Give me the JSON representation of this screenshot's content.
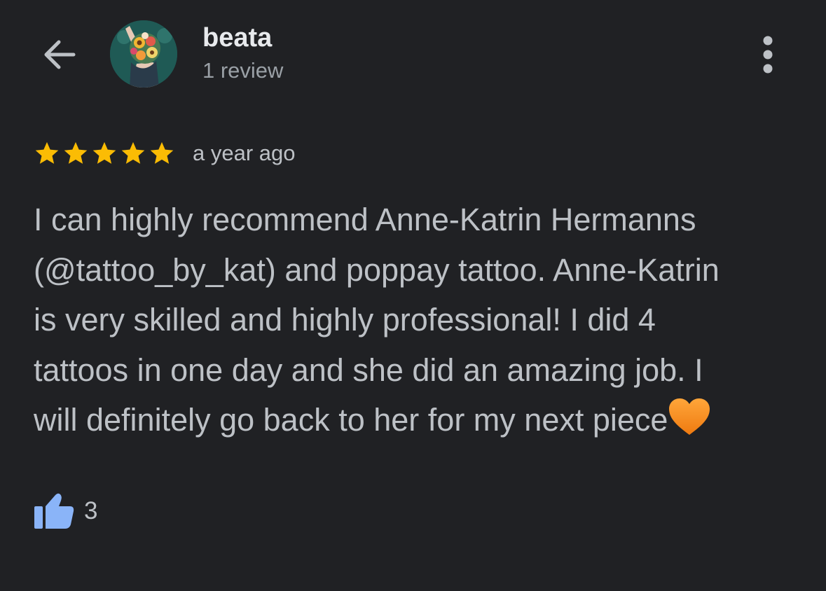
{
  "header": {
    "back_icon": "arrow-left-icon",
    "avatar_icon": "avatar-flower-illustration",
    "user_name": "beata",
    "user_subtitle": "1 review",
    "more_icon": "more-vertical-icon"
  },
  "review": {
    "rating": 5,
    "rating_max": 5,
    "star_icon": "star-icon",
    "time_ago": "a year ago",
    "text": "I can highly recommend Anne-Katrin Hermanns\n(@tattoo_by_kat) and poppay tattoo. Anne-Katrin\nis very skilled and highly professional! I did 4\ntattoos in one day and she did an amazing job. I\nwill definitely go back to her for my next piece",
    "emoji": "🧡",
    "emoji_icon": "orange-heart-icon",
    "likes": "3",
    "like_icon": "thumbs-up-icon"
  },
  "colors": {
    "background": "#202124",
    "primary_text": "#e8eaed",
    "secondary_text": "#bdc1c6",
    "star": "#fbbc04",
    "like": "#8ab4f8",
    "heart": "#f28b1d"
  }
}
